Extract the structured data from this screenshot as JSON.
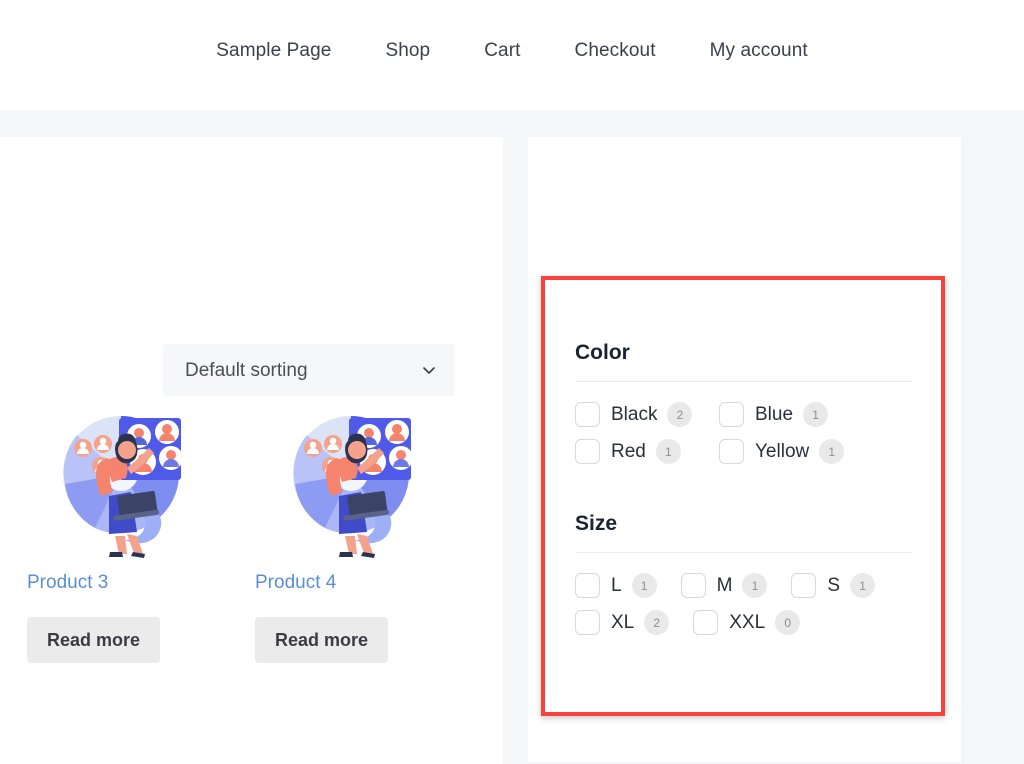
{
  "header": {
    "nav": [
      {
        "label": "Sample Page",
        "name": "nav-sample-page"
      },
      {
        "label": "Shop",
        "name": "nav-shop"
      },
      {
        "label": "Cart",
        "name": "nav-cart"
      },
      {
        "label": "Checkout",
        "name": "nav-checkout"
      },
      {
        "label": "My account",
        "name": "nav-my-account"
      }
    ]
  },
  "shop": {
    "sorting": {
      "selected": "Default sorting",
      "icon": "chevron-down-icon"
    },
    "products": [
      {
        "title": "Product 3",
        "button": "Read more"
      },
      {
        "title": "Product 4",
        "button": "Read more"
      }
    ]
  },
  "filters": {
    "highlight_color": "#f9423a",
    "groups": [
      {
        "heading": "Color",
        "layout": "two-column",
        "options": [
          {
            "label": "Black",
            "count": "2",
            "checked": false
          },
          {
            "label": "Blue",
            "count": "1",
            "checked": false
          },
          {
            "label": "Red",
            "count": "1",
            "checked": false
          },
          {
            "label": "Yellow",
            "count": "1",
            "checked": false
          }
        ]
      },
      {
        "heading": "Size",
        "layout": "inline",
        "options": [
          {
            "label": "L",
            "count": "1",
            "checked": false
          },
          {
            "label": "M",
            "count": "1",
            "checked": false
          },
          {
            "label": "S",
            "count": "1",
            "checked": false
          },
          {
            "label": "XL",
            "count": "2",
            "checked": false
          },
          {
            "label": "XXL",
            "count": "0",
            "checked": false
          }
        ]
      }
    ]
  }
}
